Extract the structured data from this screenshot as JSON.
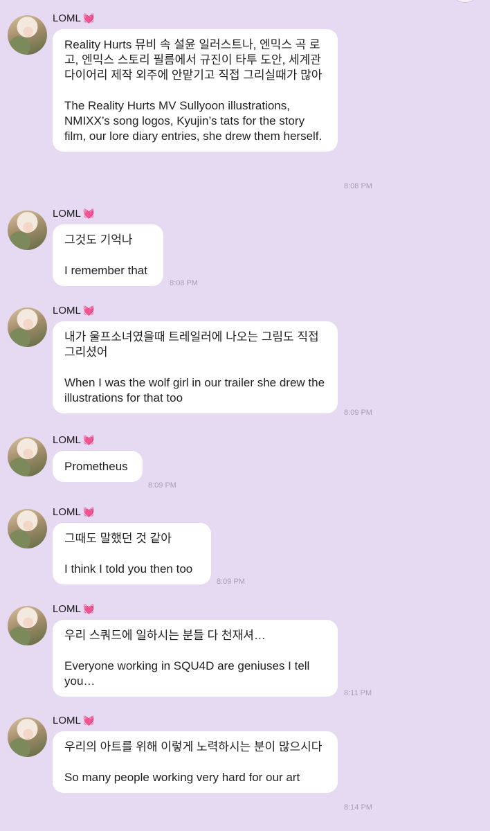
{
  "sender": {
    "name": "LOML",
    "heart": "💓"
  },
  "messages": [
    {
      "korean": "Reality Hurts 뮤비 속 설윤 일러스트나, 엔믹스 곡 로고, 엔믹스 스토리 필름에서 규진이 타투 도안, 세계관 다이어리 제작 외주에 안맡기고 직접 그리실때가 많아",
      "english": "The Reality Hurts MV Sullyoon illustrations, NMIXX’s song logos, Kyujin’s tats for the story film, our lore diary entries, she drew them herself.",
      "time": "8:08 PM"
    },
    {
      "korean": "그것도 기억나",
      "english": "I remember that",
      "time": "8:08 PM"
    },
    {
      "korean": "내가 울프소녀였을때 트레일러에 나오는 그림도 직접 그리셨어",
      "english": "When I was the wolf girl in our trailer she drew the illustrations for that too",
      "time": "8:09 PM"
    },
    {
      "korean": "Prometheus",
      "english": "",
      "time": "8:09 PM"
    },
    {
      "korean": "그때도 말했던 것 같아",
      "english": "I think I told you then too",
      "time": "8:09 PM"
    },
    {
      "korean": "우리 스쿼드에 일하시는 분들 다 천재셔…",
      "english": "Everyone working in SQU4D are geniuses I tell you…",
      "time": "8:11 PM"
    },
    {
      "korean": "우리의 아트를 위해 이렇게 노력하시는 분이 많으시다",
      "english": "So many people working very hard for our art",
      "time": "8:14 PM"
    }
  ]
}
